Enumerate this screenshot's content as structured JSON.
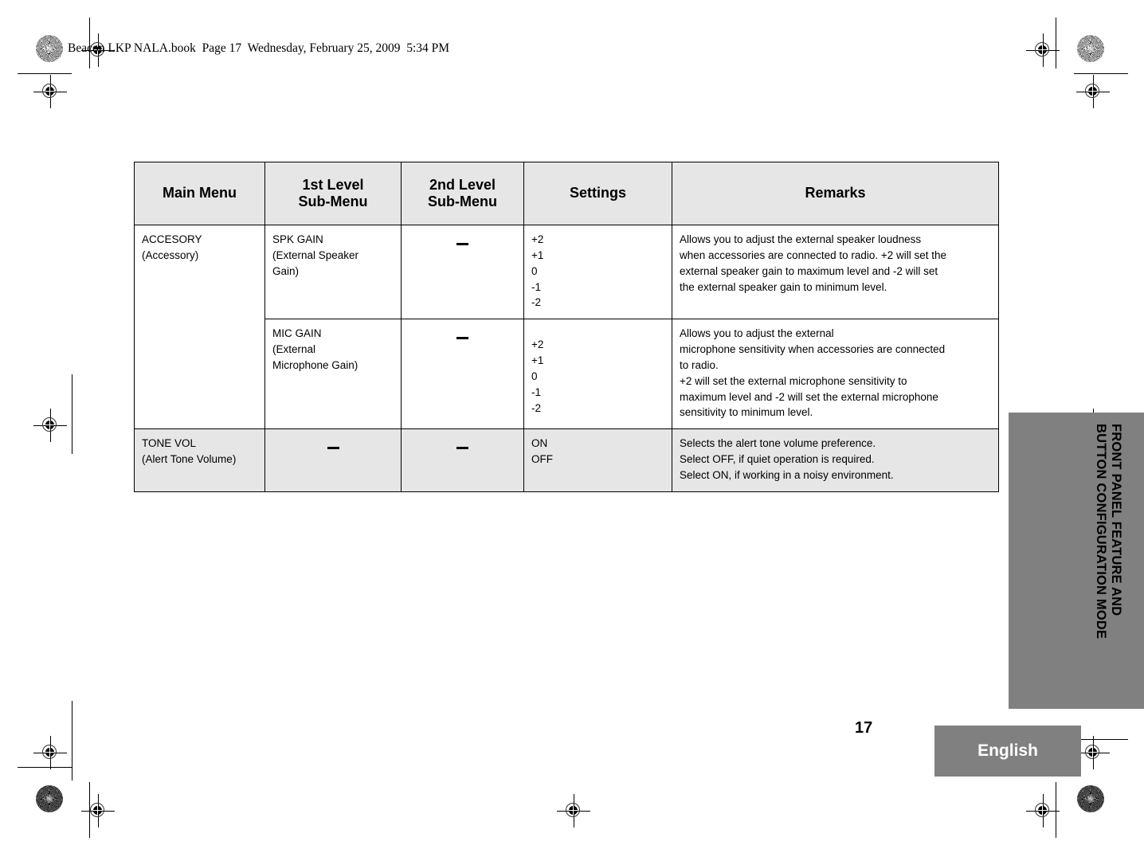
{
  "document": {
    "running_header": "Beacon LKP NALA.book  Page 17  Wednesday, February 25, 2009  5:34 PM",
    "page_number": "17",
    "language_tab": "English",
    "side_tab_text": "FRONT PANEL FEATURE AND\nBUTTON CONFIGURATION MODE"
  },
  "table": {
    "headers": [
      "Main Menu",
      "1st Level\nSub-Menu",
      "2nd Level\nSub-Menu",
      "Settings",
      "Remarks"
    ],
    "rows": [
      {
        "main_menu": "ACCESORY\n(Accessory)",
        "sub1": "SPK GAIN\n(External Speaker\nGain)",
        "sub2": "—",
        "settings": "+2\n+1\n0\n-1\n-2",
        "remarks": "Allows you to adjust the external speaker loudness\nwhen accessories are connected to radio. +2 will set the\nexternal speaker gain to maximum level and -2 will set\nthe external speaker gain to minimum level.",
        "shaded": false
      },
      {
        "main_menu": "",
        "sub1": "MIC GAIN\n(External\nMicrophone Gain)",
        "sub2": "—",
        "settings": "+2\n+1\n0\n-1\n-2",
        "remarks": "Allows you to adjust the external\nmicrophone sensitivity when accessories are connected\nto radio.\n+2 will set the external microphone sensitivity to\nmaximum level and  -2 will set the external microphone\nsensitivity to minimum level.",
        "shaded": false
      },
      {
        "main_menu": "TONE VOL\n(Alert Tone Volume)",
        "sub1": "—",
        "sub2": "—",
        "settings": "ON\nOFF",
        "remarks": "Selects the alert tone volume preference.\nSelect OFF, if quiet operation is required.\nSelect ON, if working in a noisy environment.",
        "shaded": true
      }
    ]
  },
  "colors": {
    "header_fill": "#e6e6e6",
    "shaded_row_fill": "#e6e6e6",
    "tab_fill": "#808080",
    "tab_text": "#ffffff"
  }
}
